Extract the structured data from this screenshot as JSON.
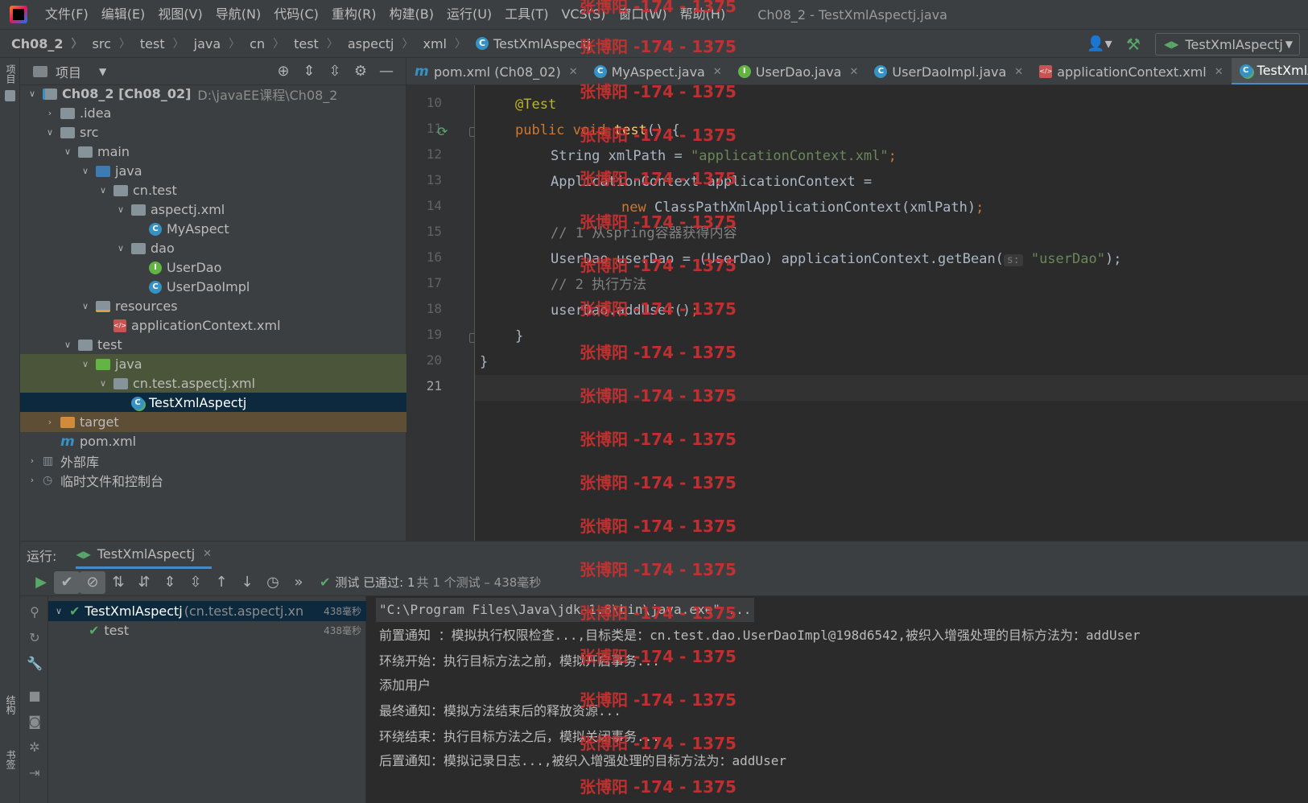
{
  "menubar": {
    "items": [
      "文件(F)",
      "编辑(E)",
      "视图(V)",
      "导航(N)",
      "代码(C)",
      "重构(R)",
      "构建(B)",
      "运行(U)",
      "工具(T)",
      "VCS(S)",
      "窗口(W)",
      "帮助(H)"
    ],
    "window_title": "Ch08_2 - TestXmlAspectj.java"
  },
  "navbar": {
    "breadcrumbs": [
      "Ch08_2",
      "src",
      "test",
      "java",
      "cn",
      "test",
      "aspectj",
      "xml",
      "TestXmlAspectj"
    ],
    "run_config": "TestXmlAspectj"
  },
  "left_strip": {
    "project_tab": "项目",
    "structure_tab": "结构",
    "bookmarks_tab": "书签"
  },
  "project_panel": {
    "title": "项目",
    "tree": [
      {
        "label": "Ch08_2 [Ch08_02]",
        "path": "D:\\javaEE课程\\Ch08_2"
      },
      {
        "label": ".idea"
      },
      {
        "label": "src"
      },
      {
        "label": "main"
      },
      {
        "label": "java"
      },
      {
        "label": "cn.test"
      },
      {
        "label": "aspectj.xml"
      },
      {
        "label": "MyAspect"
      },
      {
        "label": "dao"
      },
      {
        "label": "UserDao"
      },
      {
        "label": "UserDaoImpl"
      },
      {
        "label": "resources"
      },
      {
        "label": "applicationContext.xml"
      },
      {
        "label": "test"
      },
      {
        "label": "java"
      },
      {
        "label": "cn.test.aspectj.xml"
      },
      {
        "label": "TestXmlAspectj"
      },
      {
        "label": "target"
      },
      {
        "label": "pom.xml"
      },
      {
        "label": "外部库"
      },
      {
        "label": "临时文件和控制台"
      }
    ]
  },
  "editor": {
    "tabs": [
      "pom.xml (Ch08_02)",
      "MyAspect.java",
      "UserDao.java",
      "UserDaoImpl.java",
      "applicationContext.xml",
      "TestXmlAspec"
    ],
    "line_numbers": [
      "10",
      "11",
      "12",
      "13",
      "14",
      "15",
      "16",
      "17",
      "18",
      "19",
      "20",
      "21"
    ],
    "code": {
      "l10_ann": "@Test",
      "l11_kw": "public void",
      "l11_fn": "test",
      "l11_rest": "() {",
      "l12_a": "String xmlPath = ",
      "l12_str": "\"applicationContext.xml\"",
      "l12_b": ";",
      "l13": "ApplicationContext applicationContext =",
      "l14_kw": "new",
      "l14_rest": " ClassPathXmlApplicationContext(xmlPath)",
      "l14_b": ";",
      "l15": "// 1 从spring容器获得内容",
      "l16_a": "UserDao userDao = (UserDao) applicationContext.getBean(",
      "l16_hint": "s:",
      "l16_str": "\"userDao\"",
      "l16_b": ");",
      "l17": "// 2 执行方法",
      "l18_a": "userDao.addUser()",
      "l18_b": ";",
      "l19": "}",
      "l20": "}"
    }
  },
  "run_panel": {
    "label": "运行:",
    "tab": "TestXmlAspectj",
    "status_pass": "测试 已通过: 1",
    "status_detail": "共 1 个测试 – 438毫秒",
    "tests": [
      {
        "name": "TestXmlAspectj",
        "pkg": "(cn.test.aspectj.xn",
        "time": "438毫秒"
      },
      {
        "name": "test",
        "time": "438毫秒"
      }
    ],
    "console": [
      "\"C:\\Program Files\\Java\\jdk-1.8\\bin\\java.exe\" ...",
      "前置通知 ：模拟执行权限检查...,目标类是：cn.test.dao.UserDaoImpl@198d6542,被织入增强处理的目标方法为：addUser",
      "环绕开始：执行目标方法之前，模拟开启事务...",
      "添加用户",
      "最终通知：模拟方法结束后的释放资源...",
      "环绕结束：执行目标方法之后，模拟关闭事务...",
      "后置通知：模拟记录日志...,被织入增强处理的目标方法为：addUser"
    ]
  },
  "watermark": "张博阳 -174 - 1375",
  "colors": {
    "accent": "#4a88c7",
    "success": "#59a869",
    "watermark": "#d03030"
  }
}
